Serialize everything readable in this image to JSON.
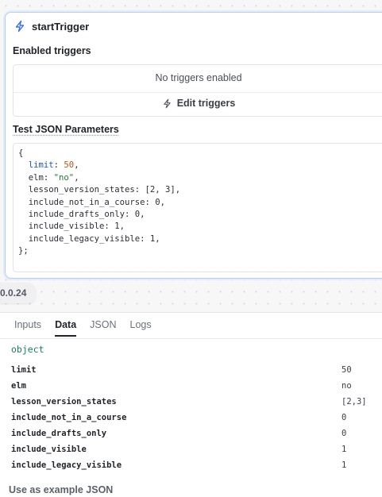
{
  "node": {
    "title": "startTrigger",
    "enabled_label": "Enabled triggers",
    "no_triggers": "No triggers enabled",
    "edit_triggers": "Edit triggers",
    "test_label": "Test JSON Parameters",
    "json_lines": {
      "open": "{",
      "limit_key": "limit",
      "limit_val": "50",
      "elm_key": "elm",
      "elm_val": "\"no\"",
      "lvs": "lesson_version_states: [2, 3],",
      "nic": "include_not_in_a_course: 0,",
      "ido": "include_drafts_only: 0,",
      "iv": "include_visible: 1,",
      "ilv": "include_legacy_visible: 1,",
      "close": "};"
    }
  },
  "version": "0.0.24",
  "panel": {
    "tabs": [
      "Inputs",
      "Data",
      "JSON",
      "Logs"
    ],
    "active_tab": "Data",
    "type": "object",
    "rows": [
      {
        "key": "limit",
        "value": "50"
      },
      {
        "key": "elm",
        "value": "no"
      },
      {
        "key": "lesson_version_states",
        "value": "[2,3]"
      },
      {
        "key": "include_not_in_a_course",
        "value": "0"
      },
      {
        "key": "include_drafts_only",
        "value": "0"
      },
      {
        "key": "include_visible",
        "value": "1"
      },
      {
        "key": "include_legacy_visible",
        "value": "1"
      }
    ],
    "use_example": "Use as example JSON"
  },
  "colors": {
    "accent": "#3b6fe0",
    "card_border": "#b9cdf0"
  }
}
